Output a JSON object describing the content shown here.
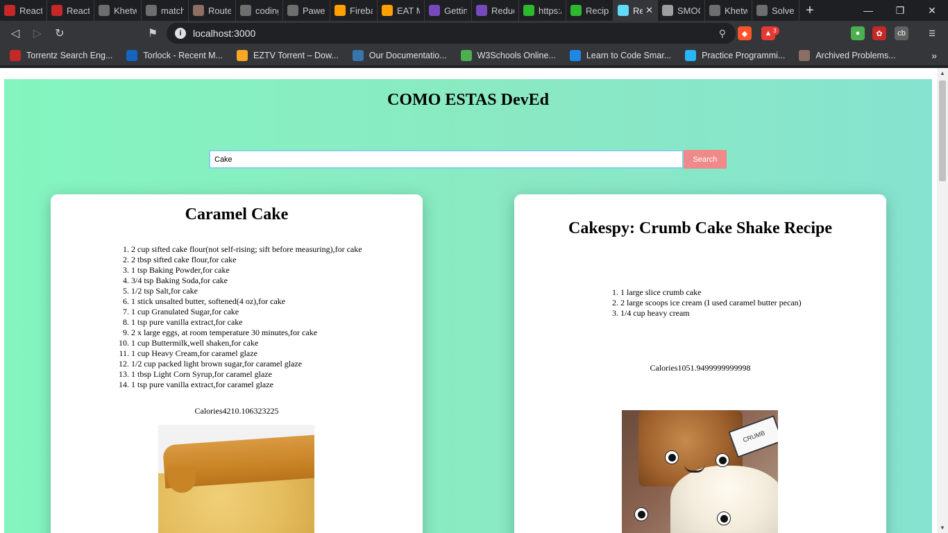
{
  "browser": {
    "tabs": [
      {
        "label": "React F",
        "icon": "react-logo-icon",
        "color": "#c62828"
      },
      {
        "label": "React F",
        "icon": "react-logo-icon",
        "color": "#c62828"
      },
      {
        "label": "Khetwa",
        "icon": "github-icon",
        "color": "#6e6e6e"
      },
      {
        "label": "match.",
        "icon": "github-icon",
        "color": "#6e6e6e"
      },
      {
        "label": "Route",
        "icon": "router-logo-icon",
        "color": "#8d6e63"
      },
      {
        "label": "coding",
        "icon": "github-icon",
        "color": "#6e6e6e"
      },
      {
        "label": "PawelF",
        "icon": "github-icon",
        "color": "#6e6e6e"
      },
      {
        "label": "Fireba",
        "icon": "firebase-icon",
        "color": "#ffa000"
      },
      {
        "label": "EAT M",
        "icon": "firebase-icon",
        "color": "#ffa000"
      },
      {
        "label": "Gettin",
        "icon": "redux-icon",
        "color": "#764abc"
      },
      {
        "label": "Reduc",
        "icon": "redux-icon",
        "color": "#764abc"
      },
      {
        "label": "https:/",
        "icon": "edamam-icon",
        "color": "#2eb82e"
      },
      {
        "label": "Recipe",
        "icon": "edamam-icon",
        "color": "#2eb82e"
      },
      {
        "label": "Re",
        "icon": "react-atom-icon",
        "color": "#61dafb",
        "active": true
      },
      {
        "label": "SMOO",
        "icon": "globe-icon",
        "color": "#9e9e9e"
      },
      {
        "label": "Khetwa",
        "icon": "github-icon",
        "color": "#6e6e6e"
      },
      {
        "label": "Solved",
        "icon": "github-icon",
        "color": "#6e6e6e"
      }
    ],
    "url": "localhost:3000",
    "extension_badge": "3",
    "bookmarks": [
      {
        "label": "Torrentz Search Eng...",
        "icon": "torrentz-icon",
        "color": "#c62828"
      },
      {
        "label": "Torlock - Recent M...",
        "icon": "torlock-icon",
        "color": "#1565c0"
      },
      {
        "label": "EZTV Torrent – Dow...",
        "icon": "eztv-icon",
        "color": "#f9a825"
      },
      {
        "label": "Our Documentatio...",
        "icon": "python-icon",
        "color": "#3776ab"
      },
      {
        "label": "W3Schools Online...",
        "icon": "w3schools-icon",
        "color": "#4caf50"
      },
      {
        "label": "Learn to Code Smar...",
        "icon": "learn-code-icon",
        "color": "#1e88e5"
      },
      {
        "label": "Practice Programmi...",
        "icon": "hackerearth-icon",
        "color": "#29b6f6"
      },
      {
        "label": "Archived Problems...",
        "icon": "project-euler-icon",
        "color": "#8d6e63"
      }
    ]
  },
  "app": {
    "title": "COMO ESTAS DevEd",
    "search": {
      "value": "Cake",
      "button_label": "Search"
    },
    "recipes": [
      {
        "title": "Caramel Cake",
        "ingredients": [
          "2 cup sifted cake flour(not self-rising; sift before measuring),for cake",
          "2 tbsp sifted cake flour,for cake",
          "1 tsp Baking Powder,for cake",
          "3/4 tsp Baking Soda,for cake",
          "1/2 tsp Salt,for cake",
          "1 stick unsalted butter, softened(4 oz),for cake",
          "1 cup Granulated Sugar,for cake",
          "1 tsp pure vanilla extract,for cake",
          "2 x large eggs, at room temperature 30 minutes,for cake",
          "1 cup Buttermilk,well shaken,for cake",
          "1 cup Heavy Cream,for caramel glaze",
          "1/2 cup packed light brown sugar,for caramel glaze",
          "1 tbsp Light Corn Syrup,for caramel glaze",
          "1 tsp pure vanilla extract,for caramel glaze"
        ],
        "calories": "Calories4210.106323225"
      },
      {
        "title": "Cakespy: Crumb Cake Shake Recipe",
        "ingredients": [
          "1 large slice crumb cake",
          "2 large scoops ice cream (I used caramel butter pecan)",
          "1/4 cup heavy cream"
        ],
        "calories": "Calories1051.9499999999998",
        "image_sign_text": "CRUMB"
      }
    ]
  }
}
